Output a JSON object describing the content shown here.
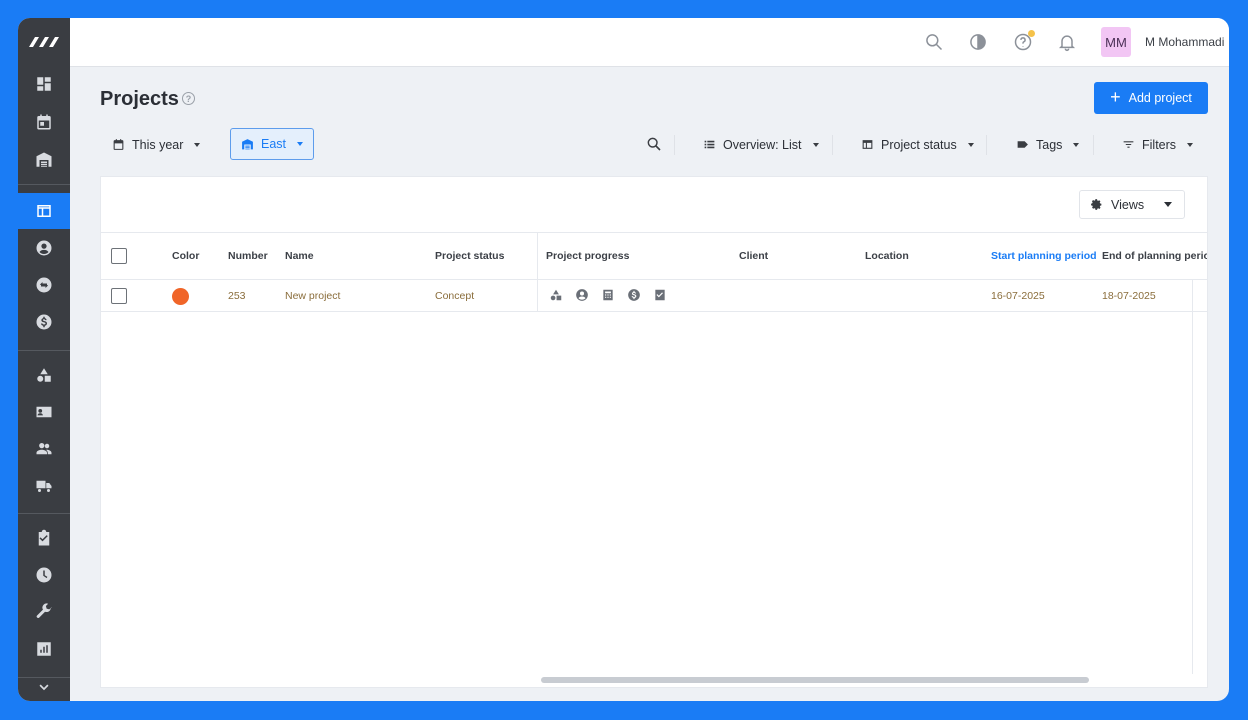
{
  "app": {
    "accent": "#1a7cf5",
    "sidebar_bg": "#3a3d42"
  },
  "sidebar": {
    "logo": "app-logo",
    "items": [
      {
        "icon": "dashboard-icon"
      },
      {
        "icon": "calendar-icon"
      },
      {
        "icon": "warehouse-icon"
      },
      {
        "icon": "projects-table-icon",
        "active": true
      },
      {
        "icon": "user-circle-icon"
      },
      {
        "icon": "sync-icon"
      },
      {
        "icon": "dollar-icon"
      },
      {
        "icon": "shapes-icon"
      },
      {
        "icon": "contact-card-icon"
      },
      {
        "icon": "people-icon"
      },
      {
        "icon": "truck-icon"
      },
      {
        "icon": "checklist-icon"
      },
      {
        "icon": "clock-icon"
      },
      {
        "icon": "wrench-icon"
      },
      {
        "icon": "report-icon"
      },
      {
        "icon": "chevron-down-icon"
      }
    ]
  },
  "topbar": {
    "avatar_initials": "MM",
    "user_name": "M Mohammadi"
  },
  "header": {
    "title": "Projects",
    "add_button": "Add project"
  },
  "filters": {
    "period": "This year",
    "region": "East",
    "overview": "Overview: List",
    "project_status": "Project status",
    "tags": "Tags",
    "filters": "Filters"
  },
  "table": {
    "views_label": "Views",
    "columns": [
      "Color",
      "Number",
      "Name",
      "Project status",
      "Project progress",
      "Client",
      "Location",
      "Start planning period",
      "End of planning perio"
    ],
    "rows": [
      {
        "color": "#f06528",
        "number": "253",
        "name": "New project",
        "status": "Concept",
        "progress_icons": [
          "shapes-icon",
          "user-circle-icon",
          "calculator-icon",
          "dollar-icon",
          "checklist-icon"
        ],
        "client": "",
        "location": "",
        "start": "16-07-2025",
        "end": "18-07-2025"
      }
    ]
  }
}
